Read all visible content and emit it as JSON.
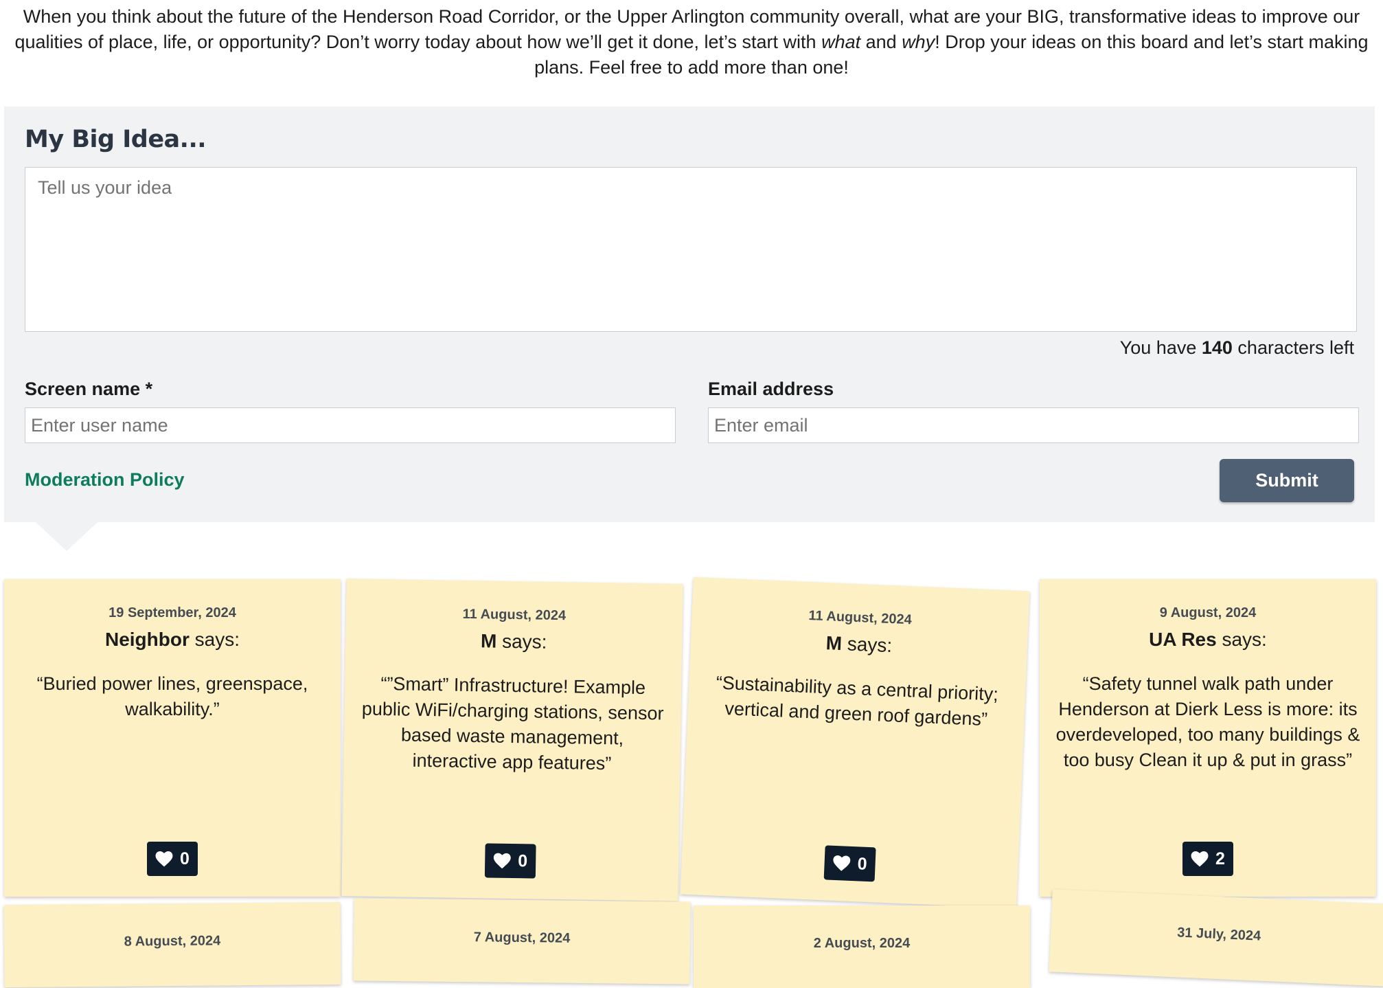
{
  "intro": {
    "part1": "When you think about the future of the Henderson Road Corridor, or the Upper Arlington community overall, what are your BIG, transformative ideas to improve our qualities of place, life, or opportunity? Don’t worry today about how we’ll get it done, let’s start with ",
    "what": "what",
    "and": " and ",
    "why": "why",
    "part2": "! Drop your ideas on this board and let’s start making plans. Feel free to add more than one!"
  },
  "form": {
    "title": "My Big Idea...",
    "idea_placeholder": "Tell us your idea",
    "chars_prefix": "You have ",
    "chars_left": "140",
    "chars_suffix": " characters left",
    "screen_name_label": "Screen name *",
    "screen_name_placeholder": "Enter user name",
    "email_label": "Email address",
    "email_placeholder": "Enter email",
    "moderation_link": "Moderation Policy",
    "submit_label": "Submit"
  },
  "says_label": " says:",
  "notes": [
    {
      "date": "19 September, 2024",
      "author": "Neighbor",
      "text": "“Buried power lines, greenspace, walkability.”",
      "likes": "0"
    },
    {
      "date": "11 August, 2024",
      "author": "M",
      "text": "“”Smart” Infrastructure! Example public WiFi/charging stations, sensor based waste management, interactive app features”",
      "likes": "0"
    },
    {
      "date": "11 August, 2024",
      "author": "M",
      "text": "“Sustainability as a central priority; vertical and green roof gardens”",
      "likes": "0"
    },
    {
      "date": "9 August, 2024",
      "author": "UA Res",
      "text": "“Safety tunnel walk path under Henderson at Dierk Less is more: its overdeveloped, too many buildings & too busy Clean it up & put in grass”",
      "likes": "2"
    }
  ],
  "peek_notes": [
    {
      "date": "8 August, 2024"
    },
    {
      "date": "7 August, 2024"
    },
    {
      "date": "2 August, 2024"
    },
    {
      "date": "31 July, 2024"
    }
  ],
  "colors": {
    "note_bg": "#fdf0c4",
    "panel_bg": "#f1f2f4",
    "link": "#0d7c5d",
    "submit_bg": "#4f6075",
    "like_bg": "#0f1c2b"
  }
}
